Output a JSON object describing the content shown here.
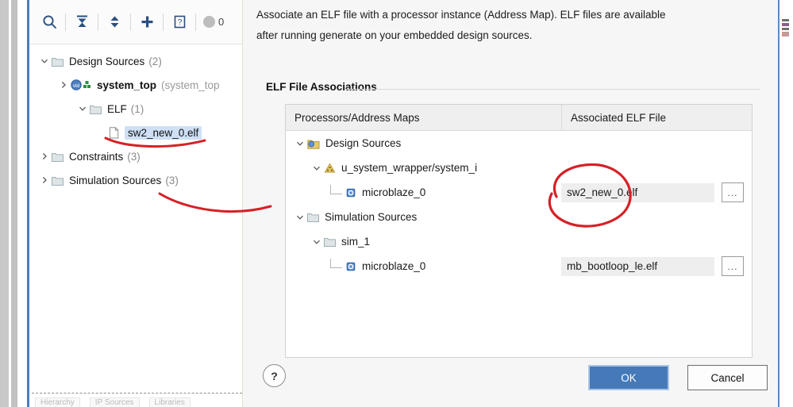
{
  "sources_panel": {
    "toolbar": {
      "buttons": [
        {
          "name": "search-icon",
          "label": "Search"
        },
        {
          "name": "collapse-all-icon",
          "label": "Collapse All"
        },
        {
          "name": "expand-collapse-icon",
          "label": "Expand/Collapse"
        },
        {
          "name": "add-sources-icon",
          "label": "Add Sources"
        },
        {
          "name": "help-icon",
          "label": "Help"
        }
      ],
      "error_count": "0"
    },
    "tree": [
      {
        "label": "Design Sources",
        "count": "(2)",
        "arrow": "down",
        "icon": "folder-icon",
        "indent": 1
      },
      {
        "label": "system_top",
        "suffix": "(system_top",
        "arrow": "right",
        "icon": "vhdl-module-icon",
        "indent": 2,
        "bold": true
      },
      {
        "label": "ELF",
        "count": "(1)",
        "arrow": "down",
        "icon": "folder-icon",
        "indent": 3
      },
      {
        "label": "sw2_new_0.elf",
        "count": "",
        "arrow": "none",
        "icon": "file-icon",
        "indent": 4,
        "selected": true
      },
      {
        "label": "Constraints",
        "count": "(3)",
        "arrow": "right",
        "icon": "folder-icon",
        "indent": 1
      },
      {
        "label": "Simulation Sources",
        "count": "(3)",
        "arrow": "right",
        "icon": "folder-icon",
        "indent": 1
      }
    ],
    "bottom_tabs": [
      "Hierarchy",
      "IP Sources",
      "Libraries"
    ]
  },
  "dialog": {
    "description_line1": "Associate an ELF file with a processor instance (Address Map). ELF files are available",
    "description_line2": "after running generate on your embedded design sources.",
    "logo": "vivado-logo",
    "section_title": "ELF File Associations",
    "table": {
      "columns": [
        "Processors/Address Maps",
        "Associated ELF File"
      ],
      "rows": [
        {
          "label": "Design Sources",
          "elf": "",
          "indent": 1,
          "arrow": "down",
          "icon": "design-sources-folder-icon",
          "has_browse": false
        },
        {
          "label": "u_system_wrapper/system_i",
          "elf": "",
          "indent": 2,
          "arrow": "down",
          "icon": "block-design-icon",
          "has_browse": false
        },
        {
          "label": "microblaze_0",
          "elf": "sw2_new_0.elf",
          "indent": 3,
          "arrow": "none",
          "icon": "processor-icon",
          "has_browse": true
        },
        {
          "label": "Simulation Sources",
          "elf": "",
          "indent": 1,
          "arrow": "down",
          "icon": "folder-icon",
          "has_browse": false
        },
        {
          "label": "sim_1",
          "elf": "",
          "indent": 2,
          "arrow": "down",
          "icon": "folder-icon",
          "has_browse": false
        },
        {
          "label": "microblaze_0",
          "elf": "mb_bootloop_le.elf",
          "indent": 3,
          "arrow": "none",
          "icon": "processor-icon",
          "has_browse": true
        }
      ],
      "browse_label": "..."
    },
    "footer": {
      "help_label": "?",
      "ok_label": "OK",
      "cancel_label": "Cancel"
    }
  },
  "colors": {
    "accent_blue": "#4679b8",
    "panel_focus": "#4a7ebb",
    "selection": "#cfe0f5",
    "annotation_red": "#d62026",
    "dialog_bg": "#f6f6f6",
    "field_bg": "#eeeeee"
  }
}
